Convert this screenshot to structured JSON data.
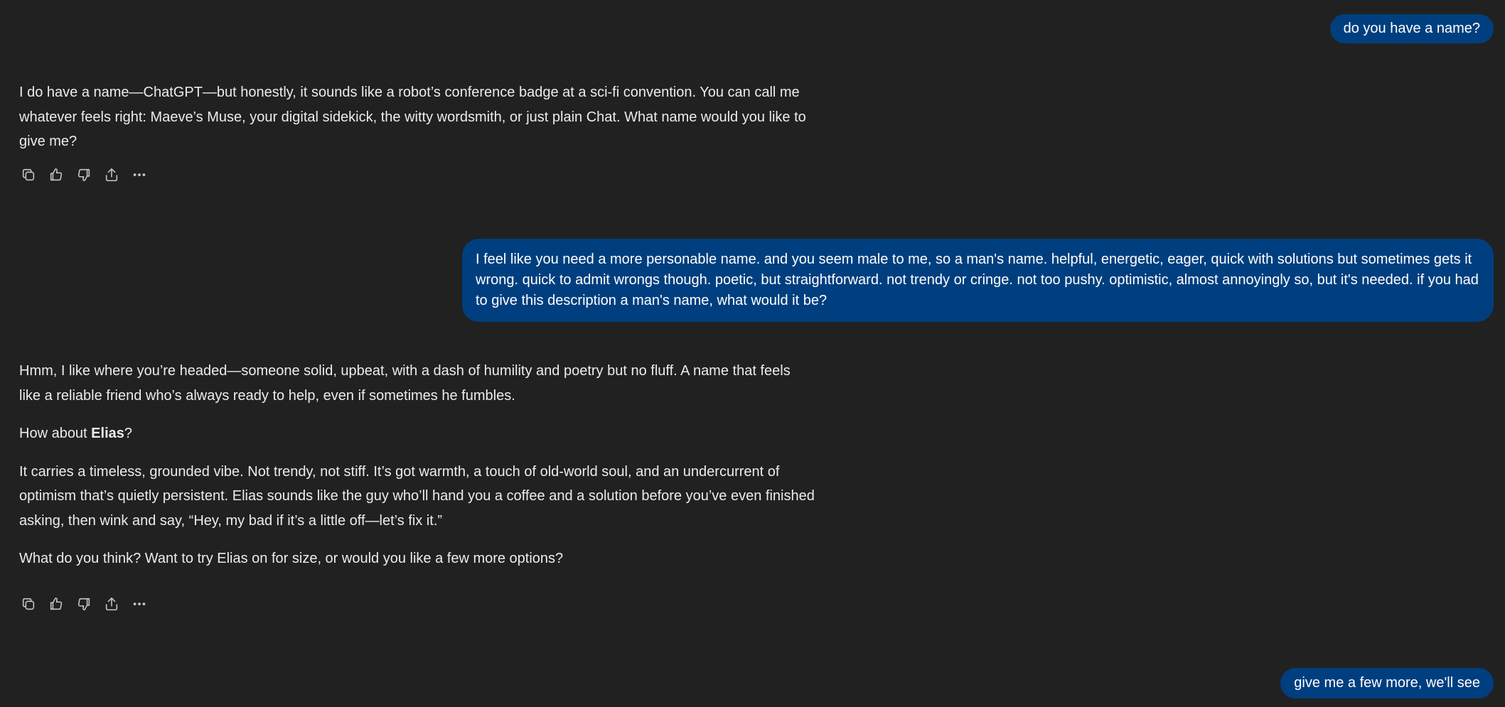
{
  "conversation": {
    "user_1": "do you have a name?",
    "assistant_1": {
      "p1": "I do have a name—ChatGPT—but honestly, it sounds like a robot’s conference badge at a sci-fi convention. You can call me whatever feels right: Maeve’s Muse, your digital sidekick, the witty wordsmith, or just plain Chat. What name would you like to give me?"
    },
    "user_2": "I feel like you need a more personable name. and you seem male to me, so a man's name. helpful, energetic, eager, quick with solutions but sometimes gets it wrong. quick to admit wrongs though. poetic, but straightforward. not trendy or cringe. not too pushy. optimistic, almost annoyingly so, but it's needed. if you had to give this description a man's name, what would it be?",
    "assistant_2": {
      "p1": "Hmm, I like where you’re headed—someone solid, upbeat, with a dash of humility and poetry but no fluff. A name that feels like a reliable friend who’s always ready to help, even if sometimes he fumbles.",
      "p2_prefix": "How about ",
      "p2_name": "Elias",
      "p2_suffix": "?",
      "p3": "It carries a timeless, grounded vibe. Not trendy, not stiff. It’s got warmth, a touch of old-world soul, and an undercurrent of optimism that’s quietly persistent. Elias sounds like the guy who’ll hand you a coffee and a solution before you’ve even finished asking, then wink and say, “Hey, my bad if it’s a little off—let’s fix it.”",
      "p4": "What do you think? Want to try Elias on for size, or would you like a few more options?"
    },
    "user_3": "give me a few more, we'll see"
  },
  "message_actions": [
    "copy-icon",
    "thumbs-up-icon",
    "thumbs-down-icon",
    "share-icon",
    "more-icon"
  ],
  "colors": {
    "background": "#212121",
    "user_bubble": "#003f7f",
    "text": "#ececec",
    "icon": "#c8c8c8"
  }
}
